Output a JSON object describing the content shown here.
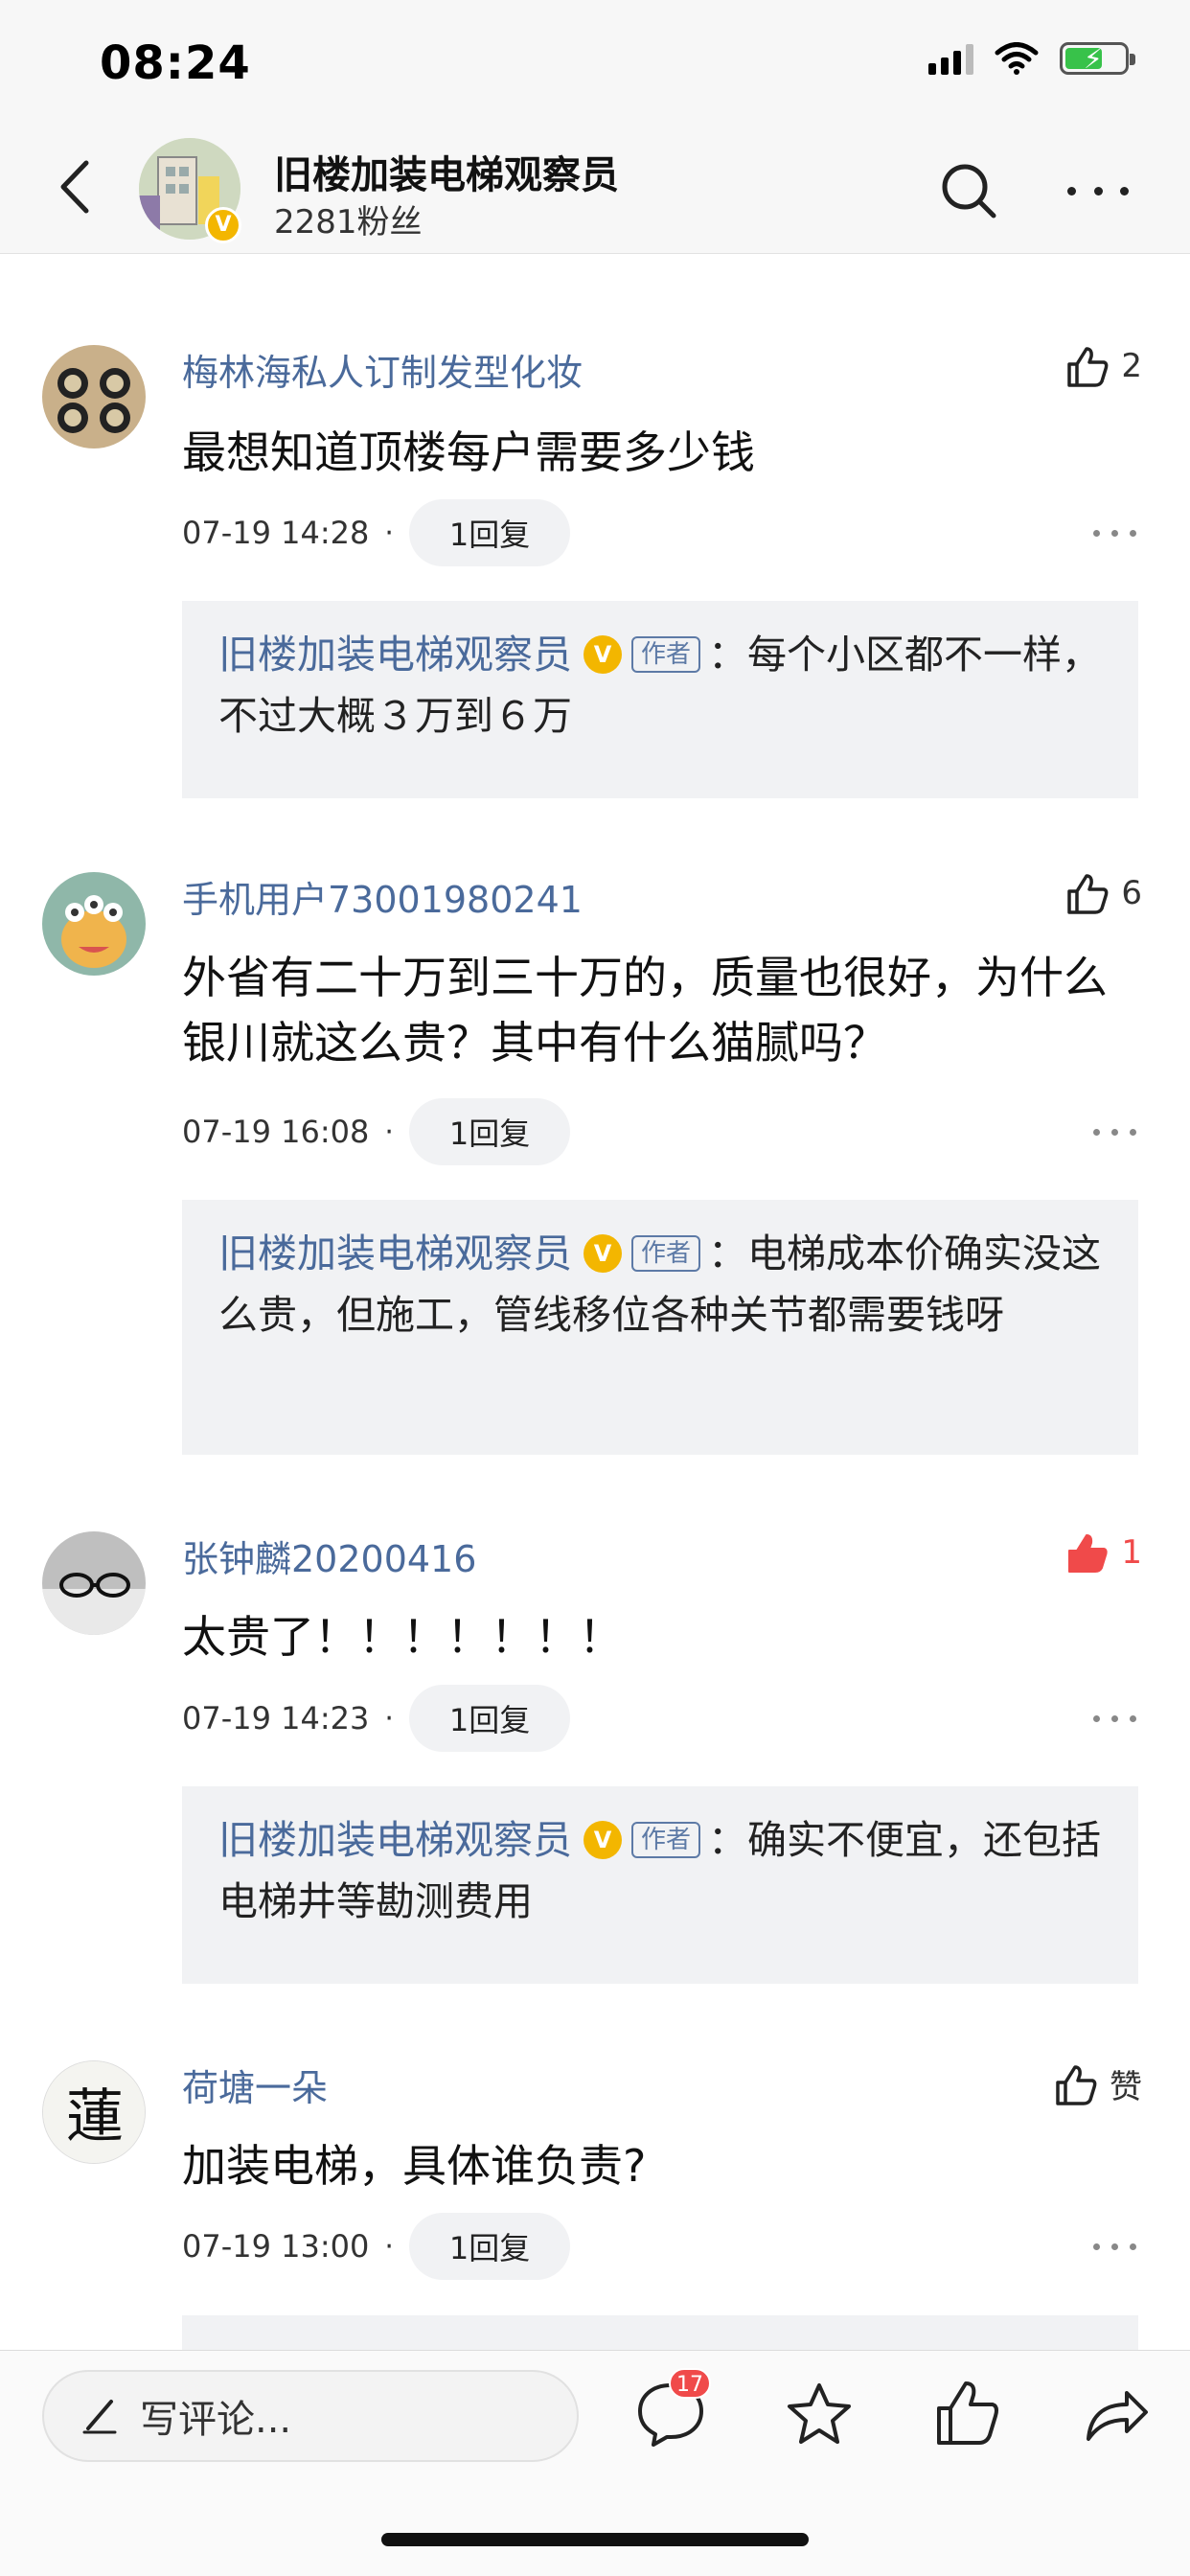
{
  "status_bar": {
    "time": "08:24"
  },
  "header": {
    "title": "旧楼加装电梯观察员",
    "followers": "2281粉丝",
    "verified_badge": "V"
  },
  "comments": [
    {
      "name": "梅林海私人订制发型化妆",
      "text": "最想知道顶楼每户需要多少钱",
      "time": "07-19 14:28",
      "replies_label": "1回复",
      "likes": "2",
      "liked": false,
      "reply": {
        "author": "旧楼加装电梯观察员",
        "tag": "作者",
        "text": "每个小区都不一样，不过大概３万到６万"
      }
    },
    {
      "name": "手机用户73001980241",
      "text": "外省有二十万到三十万的，质量也很好，为什么银川就这么贵？其中有什么猫腻吗？",
      "time": "07-19 16:08",
      "replies_label": "1回复",
      "likes": "6",
      "liked": false,
      "reply": {
        "author": "旧楼加装电梯观察员",
        "tag": "作者",
        "text": "电梯成本价确实没这么贵，但施工，管线移位各种关节都需要钱呀"
      }
    },
    {
      "name": "张钟麟20200416",
      "text": "太贵了！！！！！！！",
      "time": "07-19 14:23",
      "replies_label": "1回复",
      "likes": "1",
      "liked": true,
      "reply": {
        "author": "旧楼加装电梯观察员",
        "tag": "作者",
        "text": "确实不便宜，还包括电梯井等勘测费用"
      }
    },
    {
      "name": "荷塘一朵",
      "text": "加装电梯，具体谁负责?",
      "time": "07-19 13:00",
      "replies_label": "1回复",
      "likes": "赞",
      "liked": false,
      "avatar_text": "蓮"
    }
  ],
  "bottom_bar": {
    "write_placeholder": "写评论...",
    "comment_count": "17"
  },
  "colors": {
    "link_blue": "#4a6a9b",
    "like_red": "#f04a4a",
    "verified_gold": "#f3b600"
  }
}
